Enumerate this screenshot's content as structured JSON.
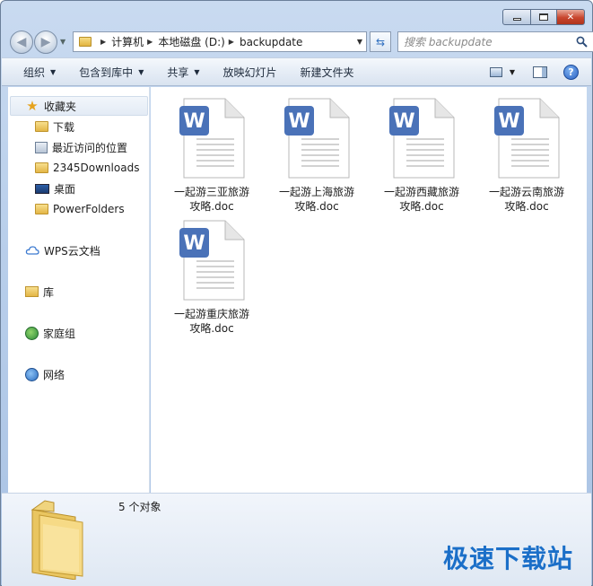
{
  "window": {
    "caption_buttons": {
      "minimize": "minimize",
      "maximize": "maximize",
      "close": "✕"
    }
  },
  "address": {
    "breadcrumbs": [
      "计算机",
      "本地磁盘 (D:)",
      "backupdate"
    ],
    "search_placeholder": "搜索 backupdate"
  },
  "toolbar": {
    "commands": [
      {
        "label": "组织",
        "has_dropdown": true
      },
      {
        "label": "包含到库中",
        "has_dropdown": true
      },
      {
        "label": "共享",
        "has_dropdown": true
      },
      {
        "label": "放映幻灯片",
        "has_dropdown": false
      },
      {
        "label": "新建文件夹",
        "has_dropdown": false
      }
    ],
    "help_label": "?"
  },
  "sidebar": {
    "favorites": {
      "label": "收藏夹",
      "icon": "star-icon"
    },
    "favorite_items": [
      {
        "label": "下载",
        "icon": "download-folder-icon"
      },
      {
        "label": "最近访问的位置",
        "icon": "recent-places-icon"
      },
      {
        "label": "2345Downloads",
        "icon": "folder-icon"
      },
      {
        "label": "桌面",
        "icon": "desktop-icon"
      },
      {
        "label": "PowerFolders",
        "icon": "folder-icon"
      }
    ],
    "sections": [
      {
        "label": "WPS云文档",
        "icon": "cloud-icon"
      },
      {
        "label": "库",
        "icon": "library-icon"
      },
      {
        "label": "家庭组",
        "icon": "homegroup-icon"
      },
      {
        "label": "网络",
        "icon": "network-icon"
      }
    ]
  },
  "files": [
    {
      "line1": "一起游三亚旅游",
      "line2": "攻略.doc",
      "icon": "wps-doc-icon",
      "icon_letter": "W"
    },
    {
      "line1": "一起游上海旅游",
      "line2": "攻略.doc",
      "icon": "wps-doc-icon",
      "icon_letter": "W"
    },
    {
      "line1": "一起游西藏旅游",
      "line2": "攻略.doc",
      "icon": "wps-doc-icon",
      "icon_letter": "W"
    },
    {
      "line1": "一起游云南旅游",
      "line2": "攻略.doc",
      "icon": "wps-doc-icon",
      "icon_letter": "W"
    },
    {
      "line1": "一起游重庆旅游",
      "line2": "攻略.doc",
      "icon": "wps-doc-icon",
      "icon_letter": "W"
    }
  ],
  "details": {
    "count_text": "5 个对象"
  },
  "watermark": {
    "text": "极速下载站"
  },
  "colors": {
    "accent": "#4a72b8",
    "watermark": "#1b6fc8"
  }
}
